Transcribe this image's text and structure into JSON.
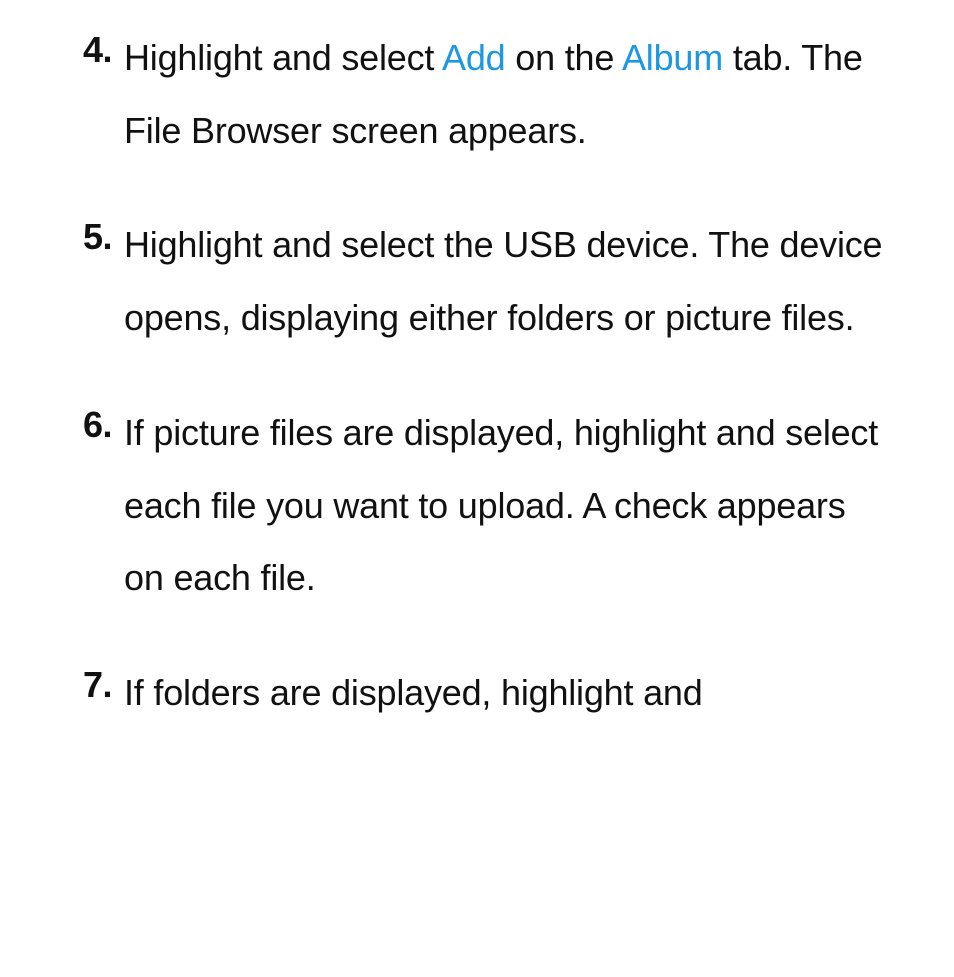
{
  "accent_color": "#1c97e1",
  "list": {
    "items": [
      {
        "number": "4.",
        "segments": [
          {
            "t": "Highlight and select "
          },
          {
            "t": "Add",
            "accent": true
          },
          {
            "t": " on the "
          },
          {
            "t": "Album",
            "accent": true
          },
          {
            "t": " tab. The File Browser screen appears."
          }
        ]
      },
      {
        "number": "5.",
        "segments": [
          {
            "t": "Highlight and select the USB device. The device opens, displaying either folders or picture files."
          }
        ]
      },
      {
        "number": "6.",
        "segments": [
          {
            "t": "If picture files are displayed, highlight and select each file you want to upload. A check appears on each file."
          }
        ]
      },
      {
        "number": "7.",
        "segments": [
          {
            "t": "If folders are displayed, highlight and"
          }
        ]
      }
    ]
  }
}
